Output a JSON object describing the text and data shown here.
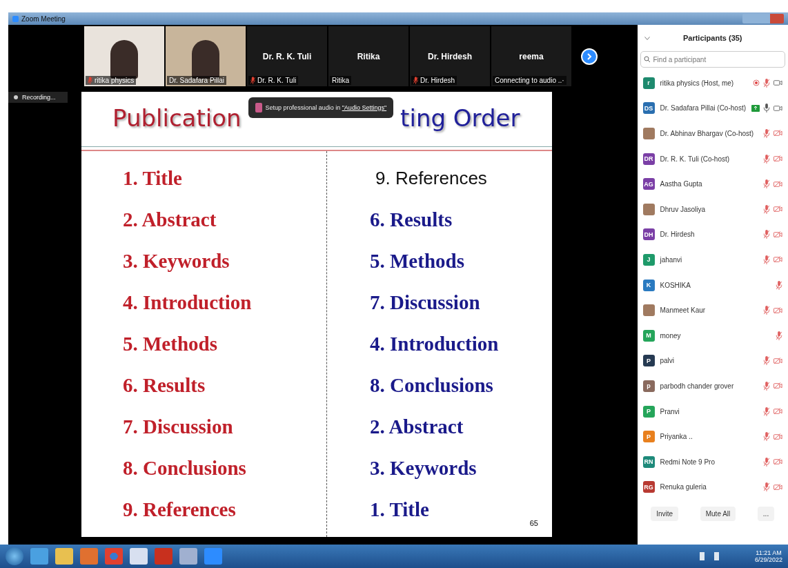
{
  "window": {
    "title": "Zoom Meeting"
  },
  "videos": [
    {
      "kind": "photo",
      "label": "ritika physics",
      "muted": true
    },
    {
      "kind": "photo",
      "label": "Dr. Sadafara Pillai",
      "muted": false
    },
    {
      "kind": "name",
      "name": "Dr. R. K. Tuli",
      "label": "Dr. R. K. Tuli",
      "muted": true
    },
    {
      "kind": "name",
      "name": "Ritika",
      "label": "Ritika",
      "muted": false
    },
    {
      "kind": "name",
      "name": "Dr. Hirdesh",
      "label": "Dr. Hirdesh",
      "muted": true
    },
    {
      "kind": "name",
      "name": "reema",
      "label": "Connecting to audio ..·",
      "muted": false
    }
  ],
  "recording": {
    "label": "Recording..."
  },
  "notice": {
    "text": "Setup professional audio in ",
    "link": "\"Audio Settings\""
  },
  "slide": {
    "left_title": "Publication",
    "right_title": "ting Order",
    "left_items": [
      "1.  Title",
      "2. Abstract",
      "3. Keywords",
      "4. Introduction",
      "5. Methods",
      "6. Results",
      "7. Discussion",
      "8. Conclusions",
      "9. References"
    ],
    "right_items": [
      {
        "text": "9. References",
        "kind": "plain"
      },
      {
        "text": "6. Results",
        "kind": "bold"
      },
      {
        "text": "5. Methods",
        "kind": "bold"
      },
      {
        "text": "7. Discussion",
        "kind": "bold"
      },
      {
        "text": "4. Introduction",
        "kind": "bold"
      },
      {
        "text": "8. Conclusions",
        "kind": "bold"
      },
      {
        "text": "2. Abstract",
        "kind": "bold"
      },
      {
        "text": "3. Keywords",
        "kind": "bold"
      },
      {
        "text": "1. Title",
        "kind": "bold"
      }
    ],
    "page": "65"
  },
  "participants": {
    "title": "Participants (35)",
    "search": {
      "placeholder": "Find a participant"
    },
    "items": [
      {
        "kind": "initials",
        "initials": "r",
        "color": "#1e8a6e",
        "name": "ritika physics (Host, me)",
        "recording": true,
        "sharing": false,
        "muted": true,
        "video_icon": true,
        "video_off": false
      },
      {
        "kind": "initials",
        "initials": "DS",
        "color": "#2a6fb0",
        "name": "Dr. Sadafara Pillai (Co-host)",
        "recording": false,
        "sharing": true,
        "muted": false,
        "video_icon": true,
        "video_off": false
      },
      {
        "kind": "photo",
        "name": "Dr. Abhinav Bhargav (Co-host)",
        "recording": false,
        "sharing": false,
        "muted": true,
        "video_icon": true,
        "video_off": true
      },
      {
        "kind": "initials",
        "initials": "DR",
        "color": "#7b3fa6",
        "name": "Dr. R. K. Tuli (Co-host)",
        "recording": false,
        "sharing": false,
        "muted": true,
        "video_icon": true,
        "video_off": true
      },
      {
        "kind": "initials",
        "initials": "AG",
        "color": "#7b3fa6",
        "name": "Aastha Gupta",
        "recording": false,
        "sharing": false,
        "muted": true,
        "video_icon": true,
        "video_off": true
      },
      {
        "kind": "photo",
        "name": "Dhruv Jasoliya",
        "recording": false,
        "sharing": false,
        "muted": true,
        "video_icon": true,
        "video_off": true
      },
      {
        "kind": "initials",
        "initials": "DH",
        "color": "#7b3fa6",
        "name": "Dr. Hirdesh",
        "recording": false,
        "sharing": false,
        "muted": true,
        "video_icon": true,
        "video_off": true
      },
      {
        "kind": "initials",
        "initials": "J",
        "color": "#1e9a6a",
        "name": "jahanvi",
        "recording": false,
        "sharing": false,
        "muted": true,
        "video_icon": true,
        "video_off": true
      },
      {
        "kind": "initials",
        "initials": "K",
        "color": "#2a7ac0",
        "name": "KOSHIKA",
        "recording": false,
        "sharing": false,
        "muted": true,
        "video_icon": false
      },
      {
        "kind": "photo",
        "name": "Manmeet Kaur",
        "recording": false,
        "sharing": false,
        "muted": true,
        "video_icon": true,
        "video_off": true
      },
      {
        "kind": "initials",
        "initials": "M",
        "color": "#25a55a",
        "name": "money",
        "recording": false,
        "sharing": false,
        "muted": true,
        "video_icon": false
      },
      {
        "kind": "initials",
        "initials": "P",
        "color": "#263a52",
        "name": "palvi",
        "recording": false,
        "sharing": false,
        "muted": true,
        "video_icon": true,
        "video_off": true
      },
      {
        "kind": "initials",
        "initials": "p",
        "color": "#8a6a5e",
        "name": "parbodh chander grover",
        "recording": false,
        "sharing": false,
        "muted": true,
        "video_icon": true,
        "video_off": true
      },
      {
        "kind": "initials",
        "initials": "P",
        "color": "#25a55a",
        "name": "Pranvi",
        "recording": false,
        "sharing": false,
        "muted": true,
        "video_icon": true,
        "video_off": true
      },
      {
        "kind": "initials",
        "initials": "P",
        "color": "#e8801e",
        "name": "Priyanka ..",
        "recording": false,
        "sharing": false,
        "muted": true,
        "video_icon": true,
        "video_off": true
      },
      {
        "kind": "initials",
        "initials": "RN",
        "color": "#1e8a7a",
        "name": "Redmi Note 9 Pro",
        "recording": false,
        "sharing": false,
        "muted": true,
        "video_icon": true,
        "video_off": true
      },
      {
        "kind": "initials",
        "initials": "RG",
        "color": "#b83a32",
        "name": "Renuka guleria",
        "recording": false,
        "sharing": false,
        "muted": true,
        "video_icon": true,
        "video_off": true
      }
    ],
    "buttons": [
      "Invite",
      "Mute All",
      "..."
    ]
  },
  "taskbar": {
    "time": "11:21 AM",
    "date": "6/29/2022"
  }
}
